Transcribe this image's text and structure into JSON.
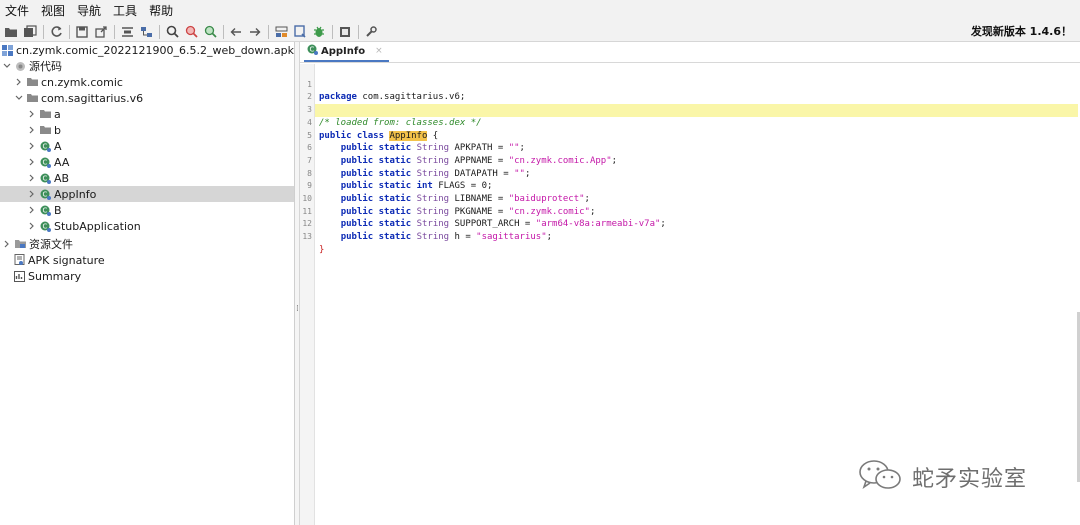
{
  "menu": [
    "文件",
    "视图",
    "导航",
    "工具",
    "帮助"
  ],
  "toolbar": {
    "buttons": [
      "open-folder-icon",
      "save-all-icon",
      "refresh-icon",
      "save-icon",
      "export-icon",
      "flatten-icon",
      "tree-icon",
      "search-icon",
      "find-class-icon",
      "find-usage-icon",
      "back-icon",
      "forward-icon",
      "deobfuscate-icon",
      "decompile-icon",
      "debug-icon",
      "log-icon",
      "settings-icon"
    ],
    "update_note": "发现新版本 1.4.6！"
  },
  "tree": {
    "root": "cn.zymk.comic_2022121900_6.5.2_web_down.apk",
    "source_code": "源代码",
    "pkg1": "cn.zymk.comic",
    "pkg2": "com.sagittarius.v6",
    "items": [
      "a",
      "b",
      "A",
      "AA",
      "AB",
      "AppInfo",
      "B",
      "StubApplication"
    ],
    "resources": "资源文件",
    "apk_signature": "APK signature",
    "summary": "Summary"
  },
  "editor": {
    "tab_label": "AppInfo",
    "tab_close": "×",
    "line_numbers": [
      "1",
      "2",
      "3",
      "4",
      "5",
      "6",
      "7",
      "8",
      "9",
      "10",
      "11",
      "12",
      "13"
    ],
    "code": {
      "l1_kw": "package",
      "l1_rest": " com.sagittarius.v6;",
      "l3_comment": "/* loaded from: classes.dex */",
      "l4_kw": "public class",
      "l4_name": "AppInfo",
      "l4_brace": " {",
      "mods": "public static",
      "str_type": "String",
      "int_type": "int",
      "l5_rest": " APKPATH = ",
      "l5_val": "\"\"",
      "l6_rest": " APPNAME = ",
      "l6_val": "\"cn.zymk.comic.App\"",
      "l7_rest": " DATAPATH = ",
      "l7_val": "\"\"",
      "l8_rest": " FLAGS = 0;",
      "l9_rest": " LIBNAME = ",
      "l9_val": "\"baiduprotect\"",
      "l10_rest": " PKGNAME = ",
      "l10_val": "\"cn.zymk.comic\"",
      "l11_rest": " SUPPORT_ARCH = ",
      "l11_val": "\"arm64-v8a:armeabi-v7a\"",
      "l12_rest": " h = ",
      "l12_val": "\"sagittarius\"",
      "semi": ";",
      "l13": "}"
    }
  },
  "watermark": "蛇矛实验室",
  "colors": {
    "selection": "#d6d6d6",
    "highlight_line": "#faf6a8",
    "keyword": "#0d2bb5",
    "string": "#c418a8",
    "comment": "#2f8a2a",
    "class_icon": "#3d8f5a"
  }
}
